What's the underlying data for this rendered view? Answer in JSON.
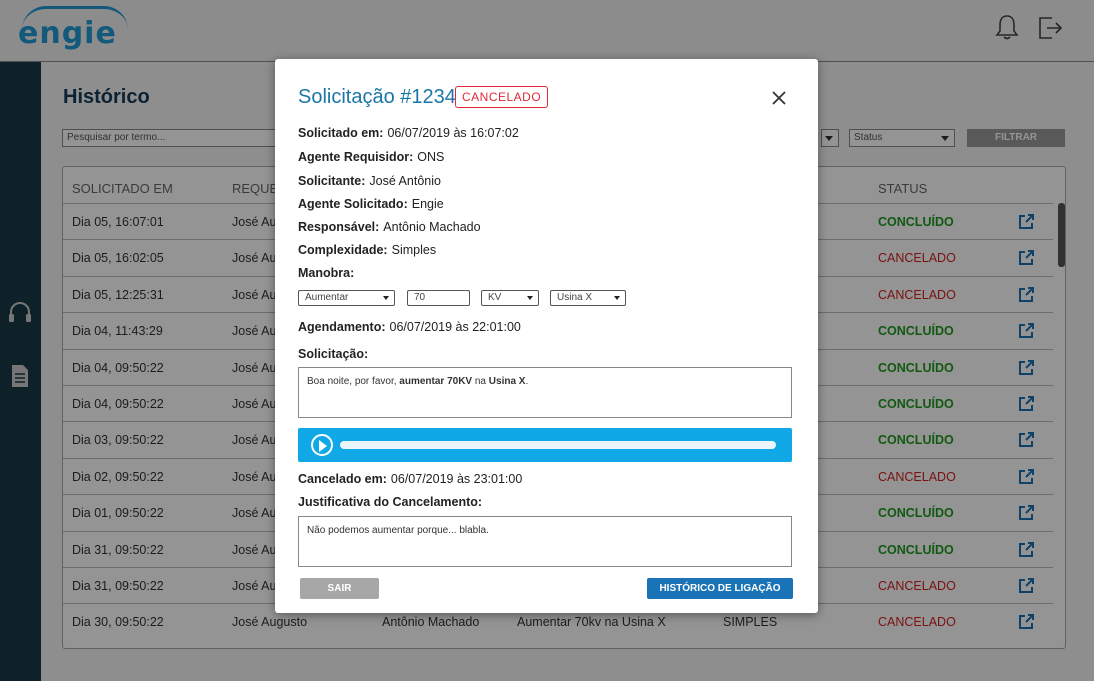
{
  "brand": {
    "logo_text": "ENGIE"
  },
  "page": {
    "title": "Histórico",
    "search_placeholder": "Pesquisar por termo...",
    "status_filter": "Status",
    "filter_button": "FILTRAR"
  },
  "table": {
    "headers": {
      "requested_at": "SOLICITADO EM",
      "requester": "REQUE",
      "status": "STATUS"
    },
    "rows": [
      {
        "date": "Dia 05, 16:07:01",
        "requester": "José Au",
        "status": "CONCLUÍDO"
      },
      {
        "date": "Dia 05, 16:02:05",
        "requester": "José Au",
        "status": "CANCELADO"
      },
      {
        "date": "Dia 05, 12:25:31",
        "requester": "José Au",
        "status": "CANCELADO"
      },
      {
        "date": "Dia 04, 11:43:29",
        "requester": "José Au",
        "status": "CONCLUÍDO"
      },
      {
        "date": "Dia 04, 09:50:22",
        "requester": "José Au",
        "status": "CONCLUÍDO"
      },
      {
        "date": "Dia 04, 09:50:22",
        "requester": "José Au",
        "status": "CONCLUÍDO"
      },
      {
        "date": "Dia 03, 09:50:22",
        "requester": "José Au",
        "status": "CONCLUÍDO"
      },
      {
        "date": "Dia 02, 09:50:22",
        "requester": "José Au",
        "status": "CANCELADO"
      },
      {
        "date": "Dia 01, 09:50:22",
        "requester": "José Au",
        "status": "CONCLUÍDO"
      },
      {
        "date": "Dia 31, 09:50:22",
        "requester": "José Au",
        "status": "CONCLUÍDO"
      },
      {
        "date": "Dia 31, 09:50:22",
        "requester": "José Au",
        "status": "CANCELADO"
      },
      {
        "date": "Dia 30, 09:50:22",
        "requester": "José Augusto",
        "responsible": "Antônio Machado",
        "request": "Aumentar 70kv na Usina X",
        "complexity": "SIMPLES",
        "status": "CANCELADO"
      }
    ]
  },
  "modal": {
    "title": "Solicitação #1234",
    "badge": "CANCELADO",
    "requested_at_label": "Solicitado em:",
    "requested_at": "06/07/2019 às 16:07:02",
    "requester_agent_label": "Agente Requisidor:",
    "requester_agent": "ONS",
    "requester_label": "Solicitante:",
    "requester": "José Antônio",
    "requested_agent_label": "Agente Solicitado:",
    "requested_agent": "Engie",
    "responsible_label": "Responsável:",
    "responsible": "Antônio Machado",
    "complexity_label": "Complexidade:",
    "complexity": "Simples",
    "maneuver_label": "Manobra:",
    "maneuver_action": "Aumentar",
    "maneuver_value": "70",
    "maneuver_unit": "KV",
    "maneuver_plant": "Usina X",
    "schedule_label": "Agendamento:",
    "schedule": "06/07/2019 às 22:01:00",
    "request_label": "Solicitação:",
    "request_text_pre": "Boa noite, por favor, ",
    "request_text_bold1": "aumentar 70KV",
    "request_text_mid": " na ",
    "request_text_bold2": "Usina X",
    "request_text_post": ".",
    "canceled_at_label": "Cancelado em:",
    "canceled_at": "06/07/2019 às 23:01:00",
    "justification_label": "Justificativa do Cancelamento:",
    "justification": "Não podemos aumentar porque... blabla.",
    "exit_button": "SAIR",
    "history_button": "HISTÓRICO DE LIGAÇÃO"
  },
  "colors": {
    "ok": "#1f9a1f",
    "cancel": "#d21f1f",
    "accent": "#10a8e6",
    "brand": "#1f9ad6"
  },
  "icons": [
    "bell-icon",
    "logout-icon",
    "headset-icon",
    "document-icon",
    "external-link-icon",
    "close-icon",
    "play-icon"
  ]
}
